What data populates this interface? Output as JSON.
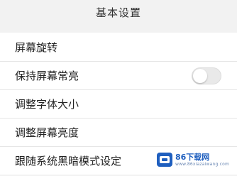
{
  "header": {
    "title": "基本设置"
  },
  "settings": {
    "items": [
      {
        "label": "屏幕旋转"
      },
      {
        "label": "保持屏幕常亮",
        "toggle_state": "off"
      },
      {
        "label": "调整字体大小"
      },
      {
        "label": "调整屏幕亮度"
      },
      {
        "label": "跟随系统黑暗模式设定"
      }
    ]
  },
  "watermark": {
    "text": "86下载网",
    "subtext": "www.86xiazaiwang.com",
    "logo_icon": "blue-square-logo"
  },
  "colors": {
    "background": "#f2f2f2",
    "row_background": "#ffffff",
    "divider": "#e6e6e6",
    "toggle_off": "#e9e9e9",
    "watermark_blue": "#1f5fbf"
  }
}
